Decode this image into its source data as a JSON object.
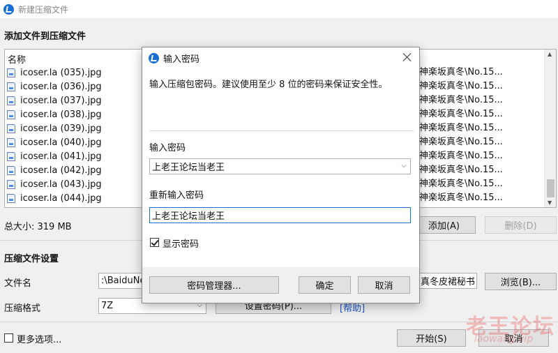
{
  "window": {
    "title": "新建压缩文件"
  },
  "add_section": {
    "title": "添加文件到压缩文件"
  },
  "file_list": {
    "header_name": "名称",
    "rows": [
      {
        "name": "icoser.la (035).jpg",
        "path": "神楽坂真冬\\No.15..."
      },
      {
        "name": "icoser.la (036).jpg",
        "path": "神楽坂真冬\\No.15..."
      },
      {
        "name": "icoser.la (037).jpg",
        "path": "神楽坂真冬\\No.15..."
      },
      {
        "name": "icoser.la (038).jpg",
        "path": "神楽坂真冬\\No.15..."
      },
      {
        "name": "icoser.la (039).jpg",
        "path": "神楽坂真冬\\No.15..."
      },
      {
        "name": "icoser.la (040).jpg",
        "path": "神楽坂真冬\\No.15..."
      },
      {
        "name": "icoser.la (041).jpg",
        "path": "神楽坂真冬\\No.15..."
      },
      {
        "name": "icoser.la (042).jpg",
        "path": "神楽坂真冬\\No.15..."
      },
      {
        "name": "icoser.la (043).jpg",
        "path": "神楽坂真冬\\No.15..."
      },
      {
        "name": "icoser.la (044).jpg",
        "path": "神楽坂真冬\\No.15..."
      }
    ]
  },
  "total_size": "总大小: 319 MB",
  "buttons": {
    "add": "添加(A)",
    "delete": "删除(D)"
  },
  "settings": {
    "title": "压缩文件设置",
    "filename_label": "文件名",
    "filename_value": ":\\BaiduNe",
    "filename_tail": "真冬皮裙秘书 [",
    "browse": "浏览(B)...",
    "format_label": "压缩格式",
    "format_value": "7Z",
    "set_password": "设置密码(P)...",
    "help": "[帮助]"
  },
  "footer": {
    "more_options": "更多选项...",
    "start": "开始(S)",
    "cancel": "取消"
  },
  "password_dialog": {
    "title": "输入密码",
    "description": "输入压缩包密码。建议使用至少 8 位的密码来保证安全性。",
    "password_label": "输入密码",
    "password_value": "上老王论坛当老王",
    "confirm_label": "重新输入密码",
    "confirm_value": "上老王论坛当老王",
    "show_password": "显示密码",
    "show_password_checked": true,
    "manager_button": "密码管理器...",
    "ok_button": "确定",
    "cancel_button": "取消"
  },
  "watermark": {
    "text": "老王论坛",
    "url": "laowang.vip"
  },
  "colors": {
    "accent": "#1a6fd6",
    "link": "#1a56c8",
    "watermark": "#e85454"
  }
}
